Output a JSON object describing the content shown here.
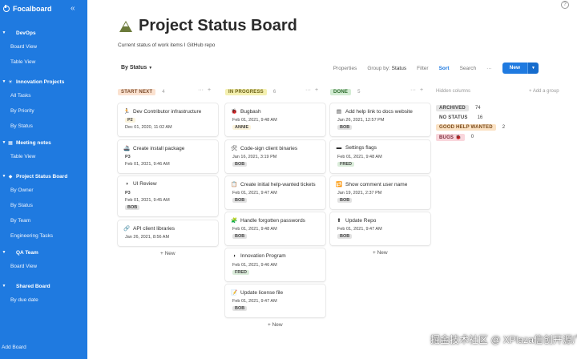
{
  "sidebar": {
    "brand": "Focalboard",
    "add_board": "Add Board",
    "boards": [
      {
        "label": "DevOps",
        "emoji": "",
        "top": 0,
        "views": [
          "Board View",
          "Table View"
        ]
      },
      {
        "label": "Innovation Projects",
        "emoji": "☀",
        "views": [
          "All Tasks",
          "By Priority",
          "By Status"
        ]
      },
      {
        "label": "Meeting notes",
        "emoji": "▦",
        "views": [
          "Table View"
        ]
      },
      {
        "label": "Project Status Board",
        "emoji": "◆",
        "views": [
          "By Owner",
          "By Status",
          "By Team",
          "Engineering Tasks"
        ]
      },
      {
        "label": "QA Team",
        "emoji": "",
        "views": [
          "Board View"
        ]
      },
      {
        "label": "Shared Board",
        "emoji": "",
        "views": [
          "By due date"
        ]
      }
    ]
  },
  "page": {
    "title": "Project Status Board",
    "description": "Current status of work items I GitHub repo"
  },
  "toolbar": {
    "view": "By Status",
    "properties": "Properties",
    "group_by": "Group by:",
    "group_by_value": "Status",
    "filter": "Filter",
    "sort": "Sort",
    "search": "Search",
    "more": "···",
    "new": "New"
  },
  "columns": [
    {
      "tag": "START NEXT",
      "tag_bg": "#fbe2d0",
      "tag_color": "#7a4a2a",
      "count": "4",
      "cards": [
        {
          "icon": "🏃",
          "title": "Dev Contributor infrastructure",
          "badge": "P2",
          "badge_type": "p2",
          "date": "Dec 01, 2020, 11:02 AM"
        },
        {
          "icon": "🚢",
          "title": "Create install package",
          "badge": "P3",
          "badge_type": "p3",
          "date": "Feb 01, 2021, 9:46 AM"
        },
        {
          "icon": "◑",
          "title": "UI Review",
          "badge": "P3",
          "badge_type": "p3",
          "date": "Feb 01, 2021, 9:45 AM",
          "user": "BOB",
          "user_type": "user"
        },
        {
          "icon": "🔗",
          "title": "API client libraries",
          "date": "Jan 26, 2021, 8:56 AM"
        }
      ],
      "add": "+ New"
    },
    {
      "tag": "IN PROGRESS",
      "tag_bg": "#f4f0b0",
      "tag_color": "#6a5f14",
      "count": "6",
      "cards": [
        {
          "icon": "🐞",
          "title": "Bugbash",
          "date": "Feb 01, 2021, 9:48 AM",
          "user": "ANNIE",
          "user_type": "anne"
        },
        {
          "icon": "🛠",
          "title": "Code-sign client binaries",
          "date": "Jan 16, 2021, 3:19 PM",
          "user": "BOB",
          "user_type": "user"
        },
        {
          "icon": "📋",
          "title": "Create initial help-wanted tickets",
          "date": "Feb 01, 2021, 9:47 AM",
          "user": "BOB",
          "user_type": "user"
        },
        {
          "icon": "🧩",
          "title": "Handle forgotten passwords",
          "date": "Feb 01, 2021, 9:48 AM",
          "user": "BOB",
          "user_type": "user"
        },
        {
          "icon": "◑",
          "title": "Innovation Program",
          "date": "Feb 01, 2021, 9:46 AM",
          "user": "FRED",
          "user_type": "fred"
        },
        {
          "icon": "📝",
          "title": "Update license file",
          "date": "Feb 01, 2021, 9:47 AM",
          "user": "BOB",
          "user_type": "user"
        }
      ],
      "add": "+ New"
    },
    {
      "tag": "DONE",
      "tag_bg": "#d3ecd3",
      "tag_color": "#2e6b2e",
      "count": "5",
      "cards": [
        {
          "icon": "▤",
          "title": "Add help link to docs website",
          "date": "Jan 26, 2021, 12:57 PM",
          "user": "BOB",
          "user_type": "user"
        },
        {
          "icon": "▬",
          "title": "Settings flags",
          "date": "Feb 01, 2021, 9:48 AM",
          "user": "FRED",
          "user_type": "fred"
        },
        {
          "icon": "🔁",
          "title": "Show comment user name",
          "date": "Jan 19, 2021, 2:37 PM",
          "user": "BOB",
          "user_type": "user"
        },
        {
          "icon": "⬆",
          "title": "Update Repo",
          "date": "Feb 01, 2021, 9:47 AM",
          "user": "BOB",
          "user_type": "user"
        }
      ],
      "add": "+ New"
    }
  ],
  "hidden": {
    "header": "Hidden columns",
    "add_group": "+ Add a group",
    "rows": [
      {
        "tag": "ARCHIVED",
        "bg": "#e4e4e4",
        "color": "#444",
        "count": "74"
      },
      {
        "tag": "NO STATUS",
        "bg": "#ffffff",
        "color": "#444",
        "count": "16"
      },
      {
        "tag": "GOOD HELP WANTED",
        "bg": "#fbe2c4",
        "color": "#7a4a1a",
        "count": "2"
      },
      {
        "tag": "BUGS 🐞",
        "bg": "#f9d6dc",
        "color": "#7a2a3a",
        "count": "0"
      }
    ]
  },
  "watermark": "掘金技术社区 @ XPlaza信创开源广场"
}
